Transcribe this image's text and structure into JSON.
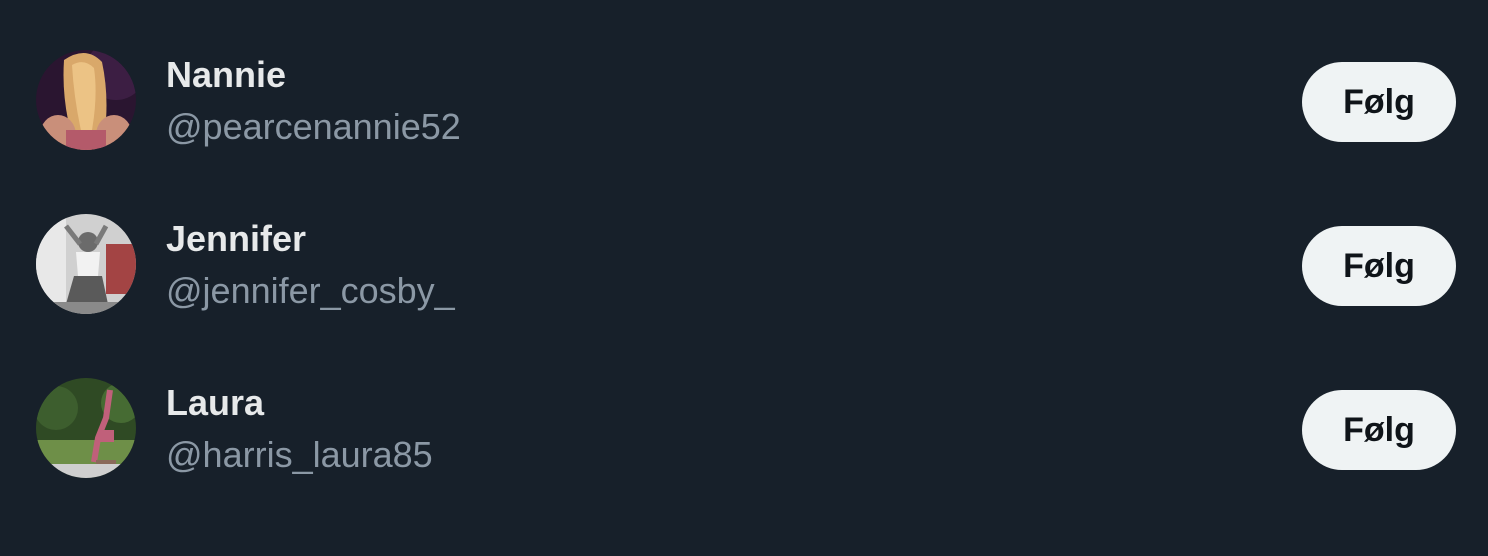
{
  "suggestions": [
    {
      "name": "Nannie",
      "handle": "@pearcenannie52",
      "follow_label": "Følg",
      "avatar_colors": [
        "#2a1530",
        "#d9a86a",
        "#b45a6a"
      ]
    },
    {
      "name": "Jennifer",
      "handle": "@jennifer_cosby_",
      "follow_label": "Følg",
      "avatar_colors": [
        "#d0d0d0",
        "#6b6b6b",
        "#9b2b2b"
      ]
    },
    {
      "name": "Laura",
      "handle": "@harris_laura85",
      "follow_label": "Følg",
      "avatar_colors": [
        "#2f4a24",
        "#6e8f48",
        "#c0607a"
      ]
    }
  ],
  "colors": {
    "background": "#17202a",
    "name": "#e7e9ea",
    "handle": "#8b98a5",
    "button_bg": "#eff3f4",
    "button_text": "#0f1419"
  }
}
